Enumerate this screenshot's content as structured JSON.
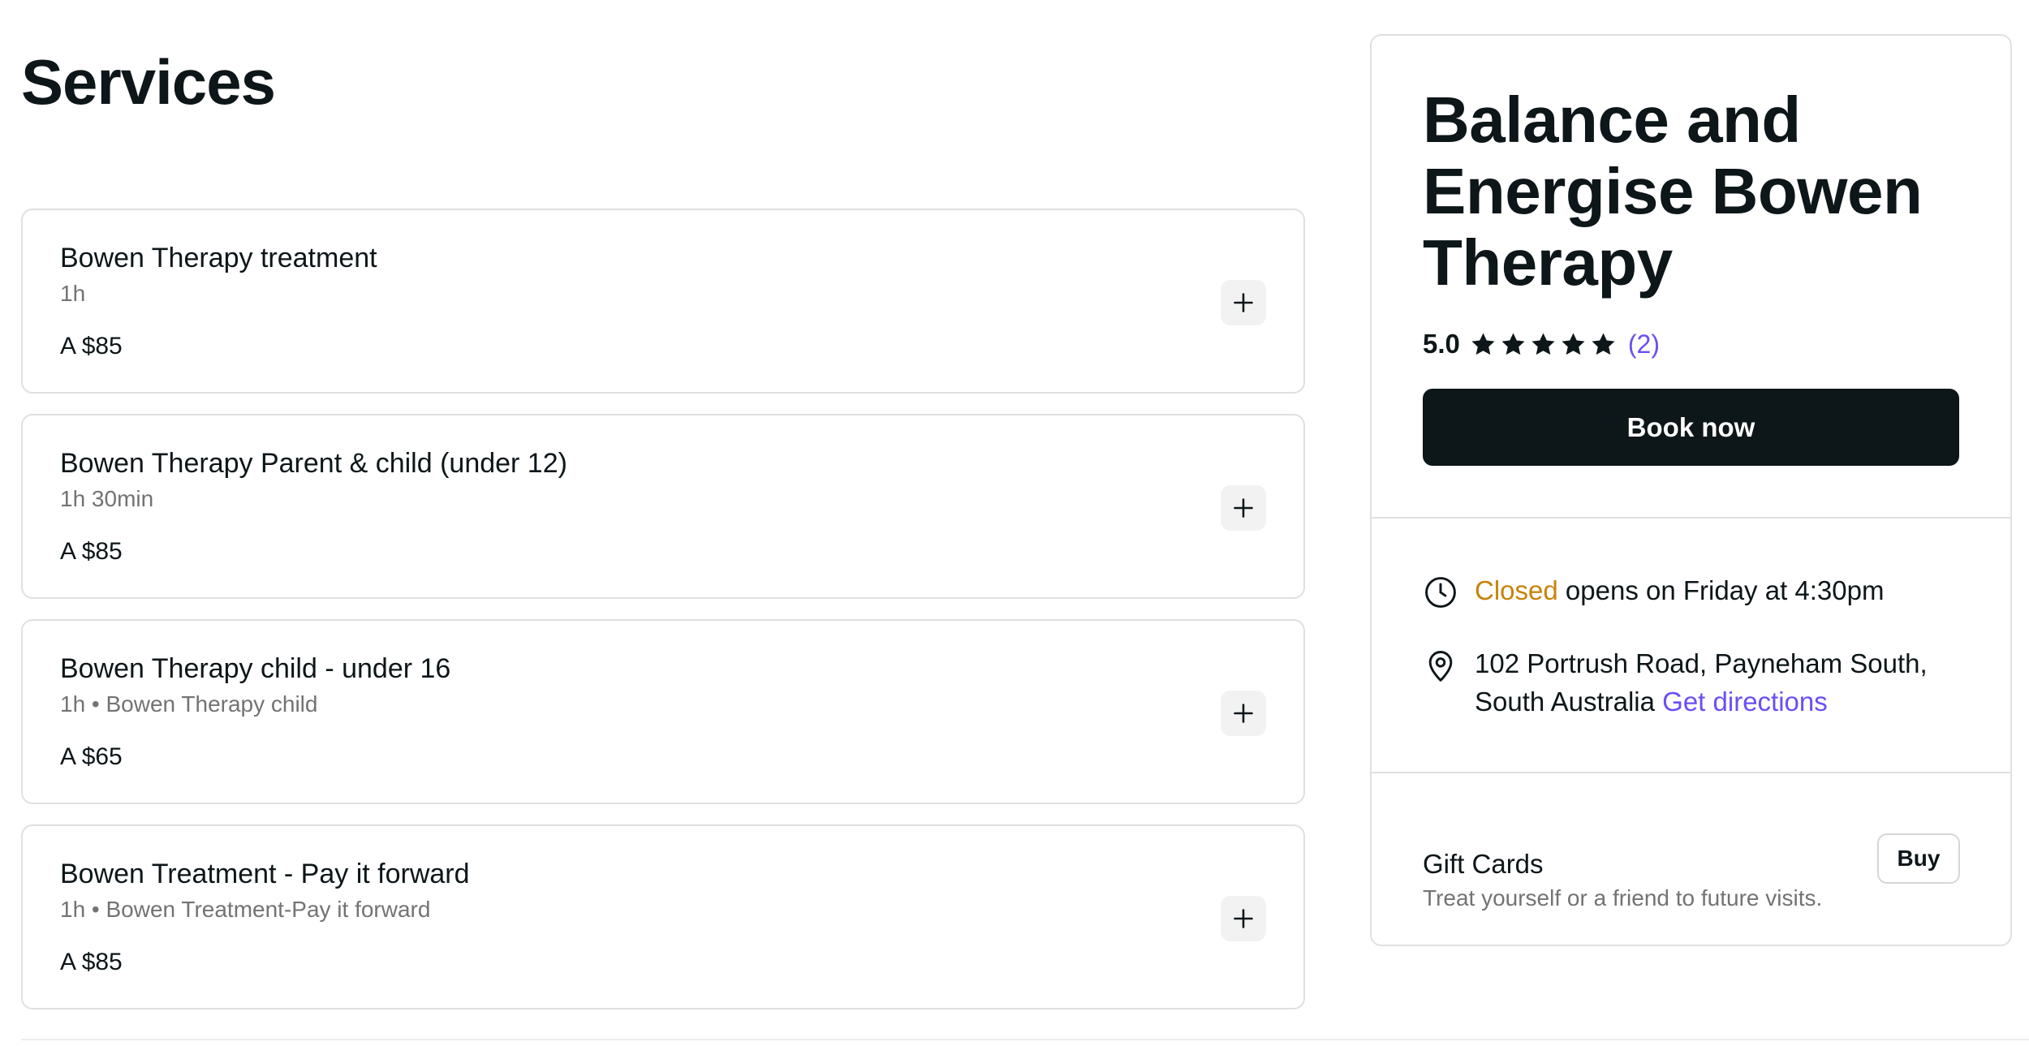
{
  "services": {
    "title": "Services",
    "items": [
      {
        "name": "Bowen Therapy treatment",
        "meta": "1h",
        "price": "A $85"
      },
      {
        "name": "Bowen Therapy Parent & child (under 12)",
        "meta": "1h 30min",
        "price": "A $85"
      },
      {
        "name": "Bowen Therapy child - under 16",
        "meta": "1h • Bowen Therapy child",
        "price": "A $65"
      },
      {
        "name": "Bowen Treatment - Pay it forward",
        "meta": "1h • Bowen Treatment-Pay it forward",
        "price": "A $85"
      }
    ],
    "add_icon": "plus-icon"
  },
  "venue": {
    "name": "Balance and Energise Bowen Therapy",
    "rating": "5.0",
    "stars": 5,
    "review_count": "(2)",
    "book_label": "Book now",
    "hours": {
      "icon": "clock-icon",
      "status": "Closed",
      "text": " opens on Friday at 4:30pm"
    },
    "address": {
      "icon": "location-pin-icon",
      "text": "102 Portrush Road, Payneham South, South Australia ",
      "directions_label": "Get directions"
    },
    "gift_cards": {
      "title": "Gift Cards",
      "subtitle": "Treat yourself or a friend to future visits.",
      "buy_label": "Buy"
    }
  },
  "colors": {
    "text": "#0d1619",
    "muted": "#737373",
    "accent": "#6950f3",
    "closed": "#c7830a",
    "button": "#0d1619"
  }
}
